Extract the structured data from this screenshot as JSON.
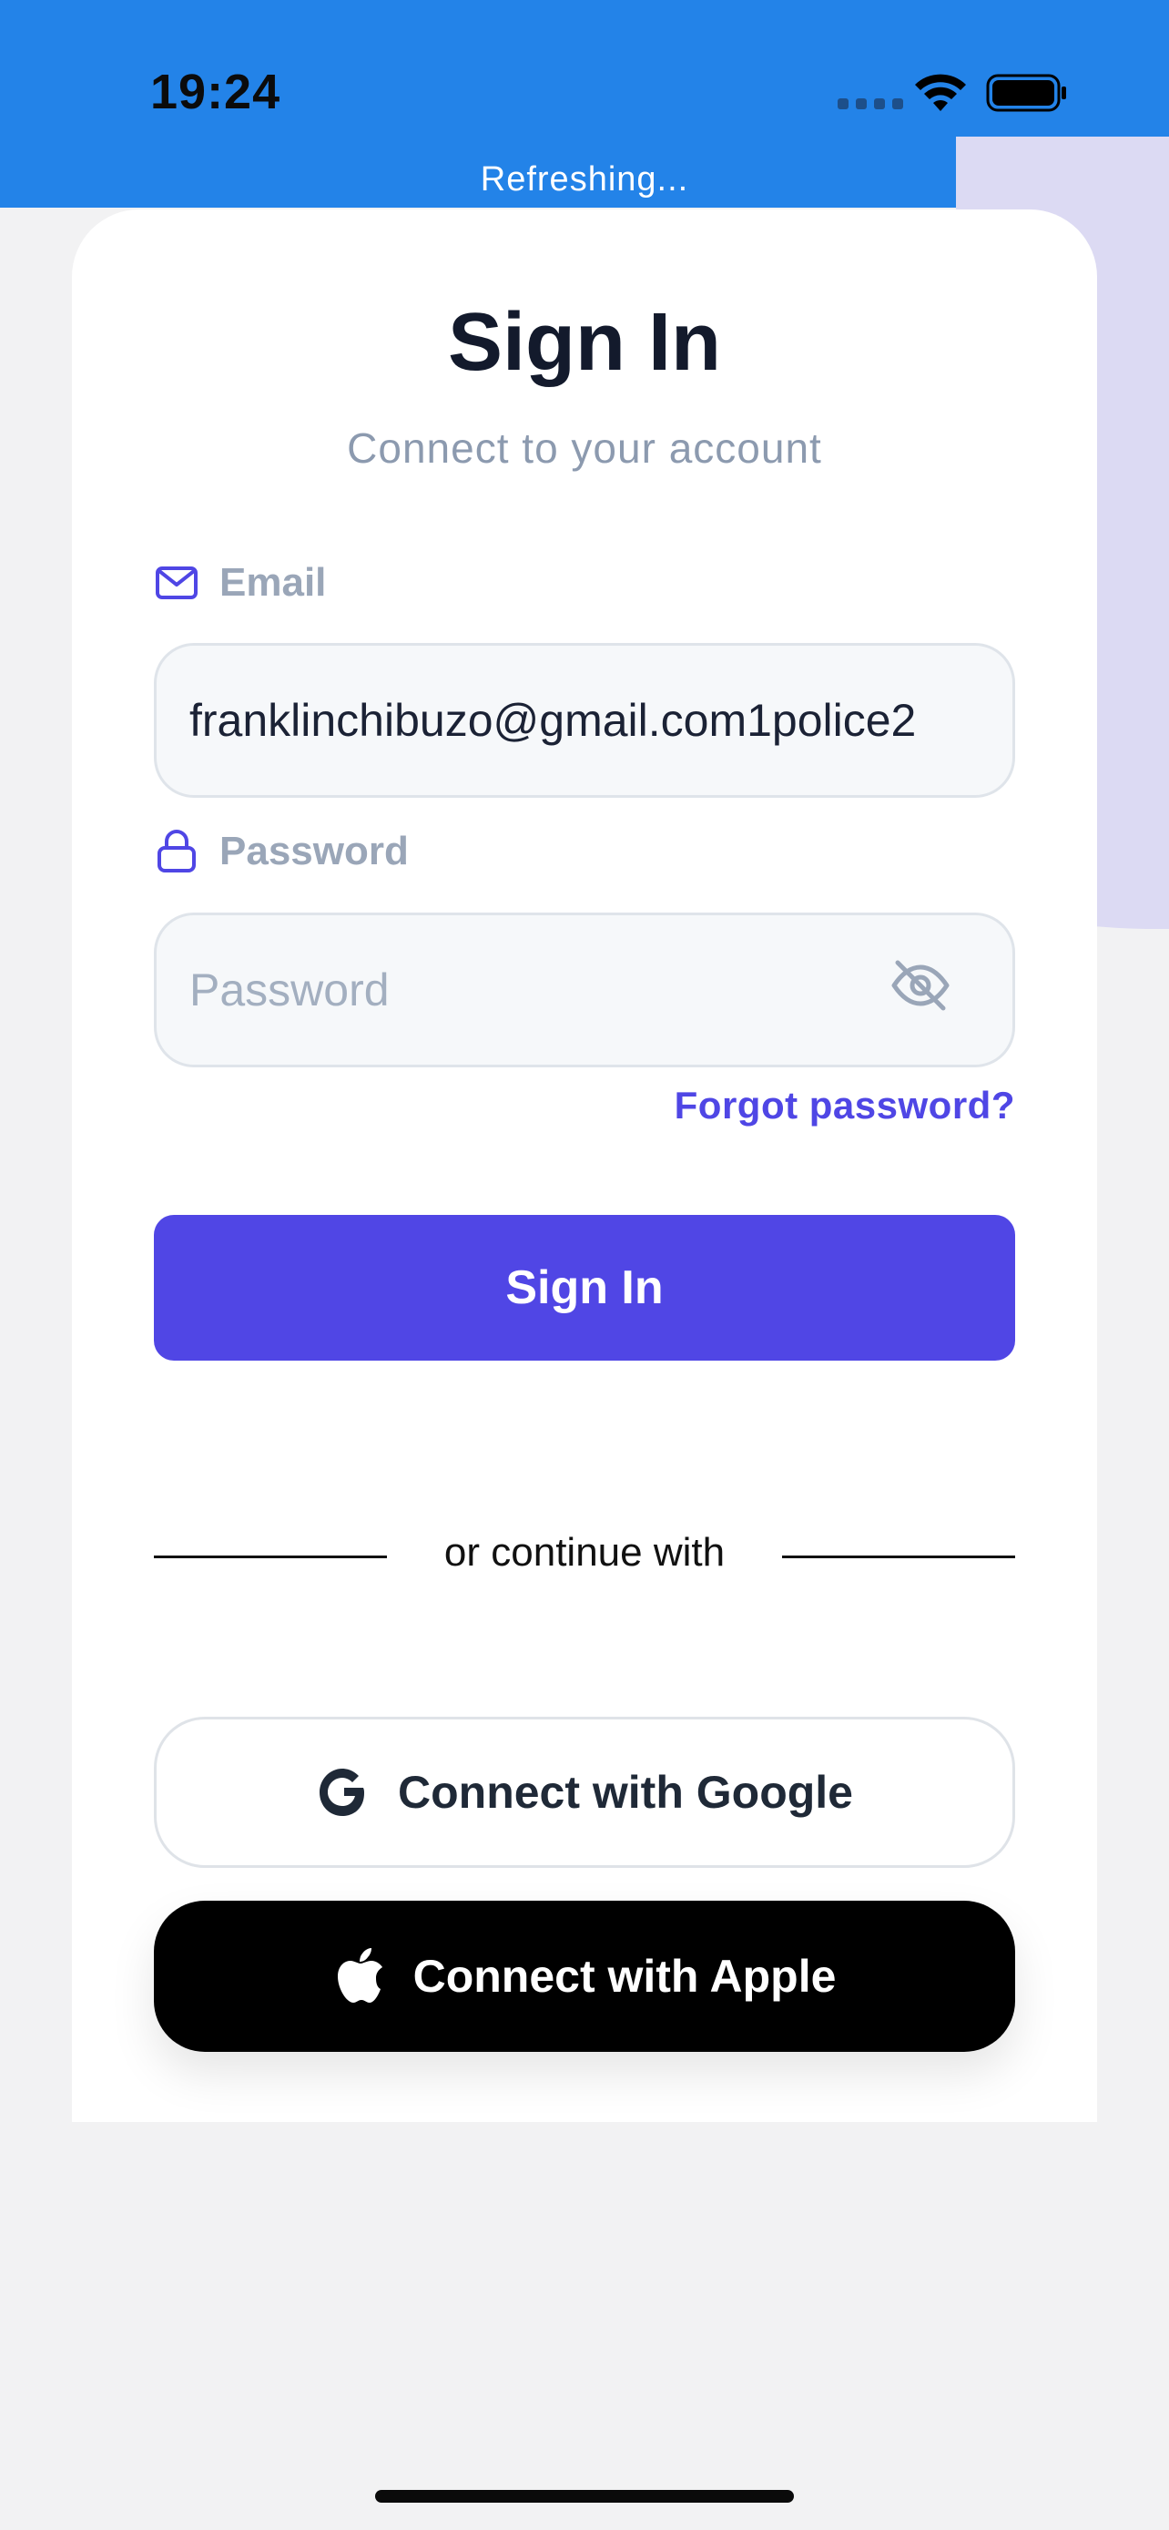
{
  "status_bar": {
    "time": "19:24",
    "refresh_text": "Refreshing...",
    "icons": [
      "signal-icon",
      "wifi-icon",
      "battery-icon"
    ]
  },
  "card": {
    "title": "Sign In",
    "subtitle": "Connect to your account"
  },
  "email_field": {
    "label": "Email",
    "icon": "mail-icon",
    "value": "franklinchibuzo@gmail.com1police2"
  },
  "password_field": {
    "label": "Password",
    "icon": "lock-icon",
    "placeholder": "Password",
    "value": "",
    "toggle_icon": "eye-off-icon"
  },
  "forgot_password": "Forgot password?",
  "sign_in_button": "Sign In",
  "divider_text": "or continue with",
  "social": {
    "google_label": "Connect with Google",
    "apple_label": "Connect with Apple"
  },
  "colors": {
    "status_bar": "#2383e8",
    "primary": "#5046e5",
    "link": "#4f46e5",
    "title": "#131a2c",
    "muted": "#8c9aaf"
  }
}
